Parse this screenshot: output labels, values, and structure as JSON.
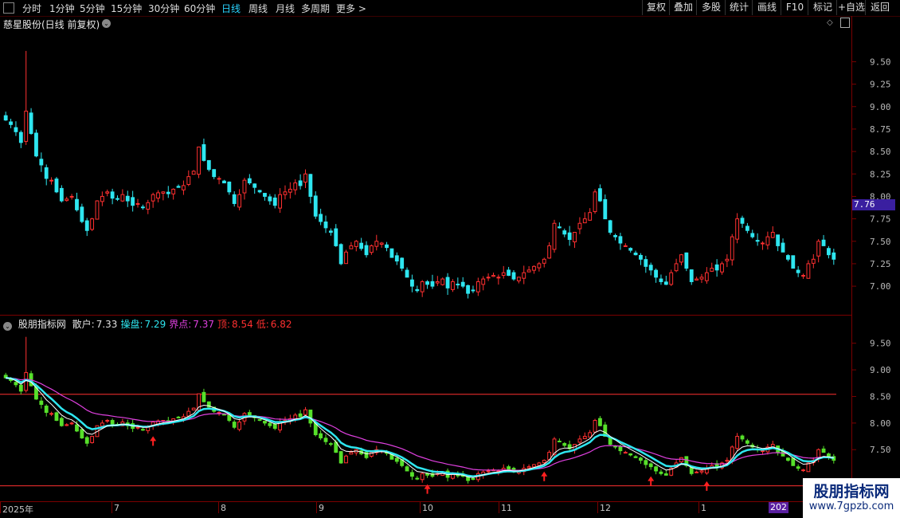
{
  "toolbar": {
    "periods": [
      "分时",
      "1分钟",
      "5分钟",
      "15分钟",
      "30分钟",
      "60分钟",
      "日线",
      "周线",
      "月线",
      "多周期",
      "更多 >"
    ],
    "active_period": "日线",
    "right_buttons": [
      "复权",
      "叠加",
      "多股",
      "统计",
      "画线",
      "F10",
      "标记",
      "+自选",
      "返回"
    ]
  },
  "main_chart": {
    "title": "慈星股份(日线 前复权)",
    "y_ticks": [
      "9.50",
      "9.25",
      "9.00",
      "8.75",
      "8.50",
      "8.25",
      "8.00",
      "7.75",
      "7.50",
      "7.25",
      "7.00"
    ],
    "current_price": "7.76"
  },
  "indicator": {
    "name": "股朋指标网",
    "values": [
      {
        "label": "散户:",
        "value": "7.33",
        "color": "#e0e0e0"
      },
      {
        "label": "操盘:",
        "value": "7.29",
        "color": "#2ee6f0"
      },
      {
        "label": "界点:",
        "value": "7.37",
        "color": "#e040e0"
      },
      {
        "label": "顶:",
        "value": "8.54",
        "color": "#ff3030"
      },
      {
        "label": "低:",
        "value": "6.82",
        "color": "#ff3030"
      }
    ],
    "y_ticks": [
      "9.50",
      "9.00",
      "8.50",
      "8.00",
      "7.50"
    ]
  },
  "date_axis": {
    "labels": [
      "2025年",
      "7",
      "8",
      "9",
      "10",
      "11",
      "12",
      "1"
    ],
    "year_badge": "202"
  },
  "watermark": {
    "title": "股朋指标网",
    "url": "www.7gpzb.com"
  },
  "colors": {
    "up": "#ff3030",
    "down": "#2ee6f0",
    "indicator_down": "#56e02a",
    "ma_white": "#ffffff",
    "ma_cyan": "#2ee6f0",
    "ma_magenta": "#e040e0",
    "grid_red": "#7a0000"
  },
  "chart_data": {
    "type": "candlestick",
    "title": "慈星股份(日线 前复权)",
    "ylim": [
      6.85,
      9.85
    ],
    "x_label_months": [
      "2025年",
      "7",
      "8",
      "9",
      "10",
      "11",
      "12",
      "1"
    ],
    "closes": [
      8.85,
      8.8,
      8.72,
      8.6,
      8.95,
      8.7,
      8.45,
      8.35,
      8.2,
      8.18,
      8.05,
      7.95,
      7.97,
      8.0,
      7.85,
      7.72,
      7.62,
      7.75,
      7.95,
      8.0,
      8.05,
      7.98,
      7.97,
      8.02,
      7.95,
      7.9,
      7.92,
      7.88,
      7.93,
      8.02,
      8.04,
      8.05,
      8.03,
      8.08,
      8.1,
      8.12,
      8.22,
      8.28,
      8.55,
      8.4,
      8.3,
      8.22,
      8.2,
      8.15,
      8.05,
      7.92,
      8.02,
      8.18,
      8.15,
      8.1,
      8.05,
      8.0,
      7.95,
      7.9,
      8.02,
      8.05,
      8.08,
      8.15,
      8.12,
      8.25,
      8.0,
      7.78,
      7.72,
      7.65,
      7.6,
      7.45,
      7.25,
      7.38,
      7.45,
      7.5,
      7.42,
      7.35,
      7.45,
      7.5,
      7.48,
      7.43,
      7.32,
      7.28,
      7.2,
      7.1,
      7.0,
      6.95,
      7.05,
      7.02,
      7.0,
      7.05,
      7.08,
      6.98,
      7.05,
      7.02,
      7.0,
      6.92,
      6.95,
      7.05,
      7.08,
      7.1,
      7.12,
      7.1,
      7.15,
      7.12,
      7.08,
      7.1,
      7.15,
      7.18,
      7.22,
      7.25,
      7.3,
      7.45,
      7.7,
      7.65,
      7.58,
      7.52,
      7.6,
      7.7,
      7.75,
      7.82,
      8.05,
      7.95,
      7.75,
      7.6,
      7.55,
      7.48,
      7.45,
      7.4,
      7.35,
      7.3,
      7.22,
      7.18,
      7.1,
      7.05,
      7.02,
      7.15,
      7.25,
      7.35,
      7.2,
      7.05,
      7.08,
      7.1,
      7.15,
      7.2,
      7.18,
      7.25,
      7.3,
      7.55,
      7.75,
      7.7,
      7.62,
      7.55,
      7.5,
      7.48,
      7.55,
      7.6,
      7.45,
      7.38,
      7.3,
      7.2,
      7.15,
      7.12,
      7.25,
      7.3,
      7.5,
      7.45,
      7.35,
      7.3
    ]
  }
}
